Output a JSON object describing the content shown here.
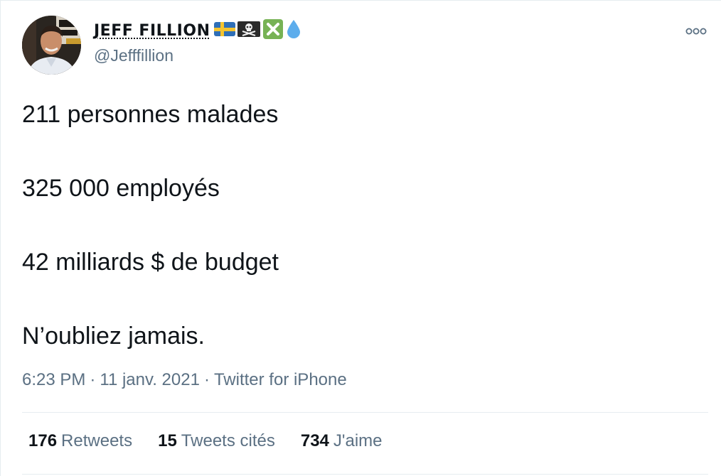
{
  "author": {
    "display_name": "JEFF FILLION",
    "handle": "@Jefffillion",
    "emoji_icons": [
      "swedish-flag-icon",
      "pirate-flag-icon",
      "cross-mark-icon",
      "droplet-icon"
    ]
  },
  "tweet": {
    "lines": [
      "211 personnes malades",
      "325 000 employés",
      "42 milliards $ de budget",
      "N’oubliez jamais."
    ],
    "time": "6:23 PM",
    "date": "11 janv. 2021",
    "source": "Twitter for iPhone",
    "separator": "·"
  },
  "stats": {
    "retweets_count": "176",
    "retweets_label": "Retweets",
    "quotes_count": "15",
    "quotes_label": "Tweets cités",
    "likes_count": "734",
    "likes_label": "J'aime"
  },
  "colors": {
    "text_primary": "#0f1419",
    "text_secondary": "#5b7083",
    "divider": "#e6ecf0"
  }
}
